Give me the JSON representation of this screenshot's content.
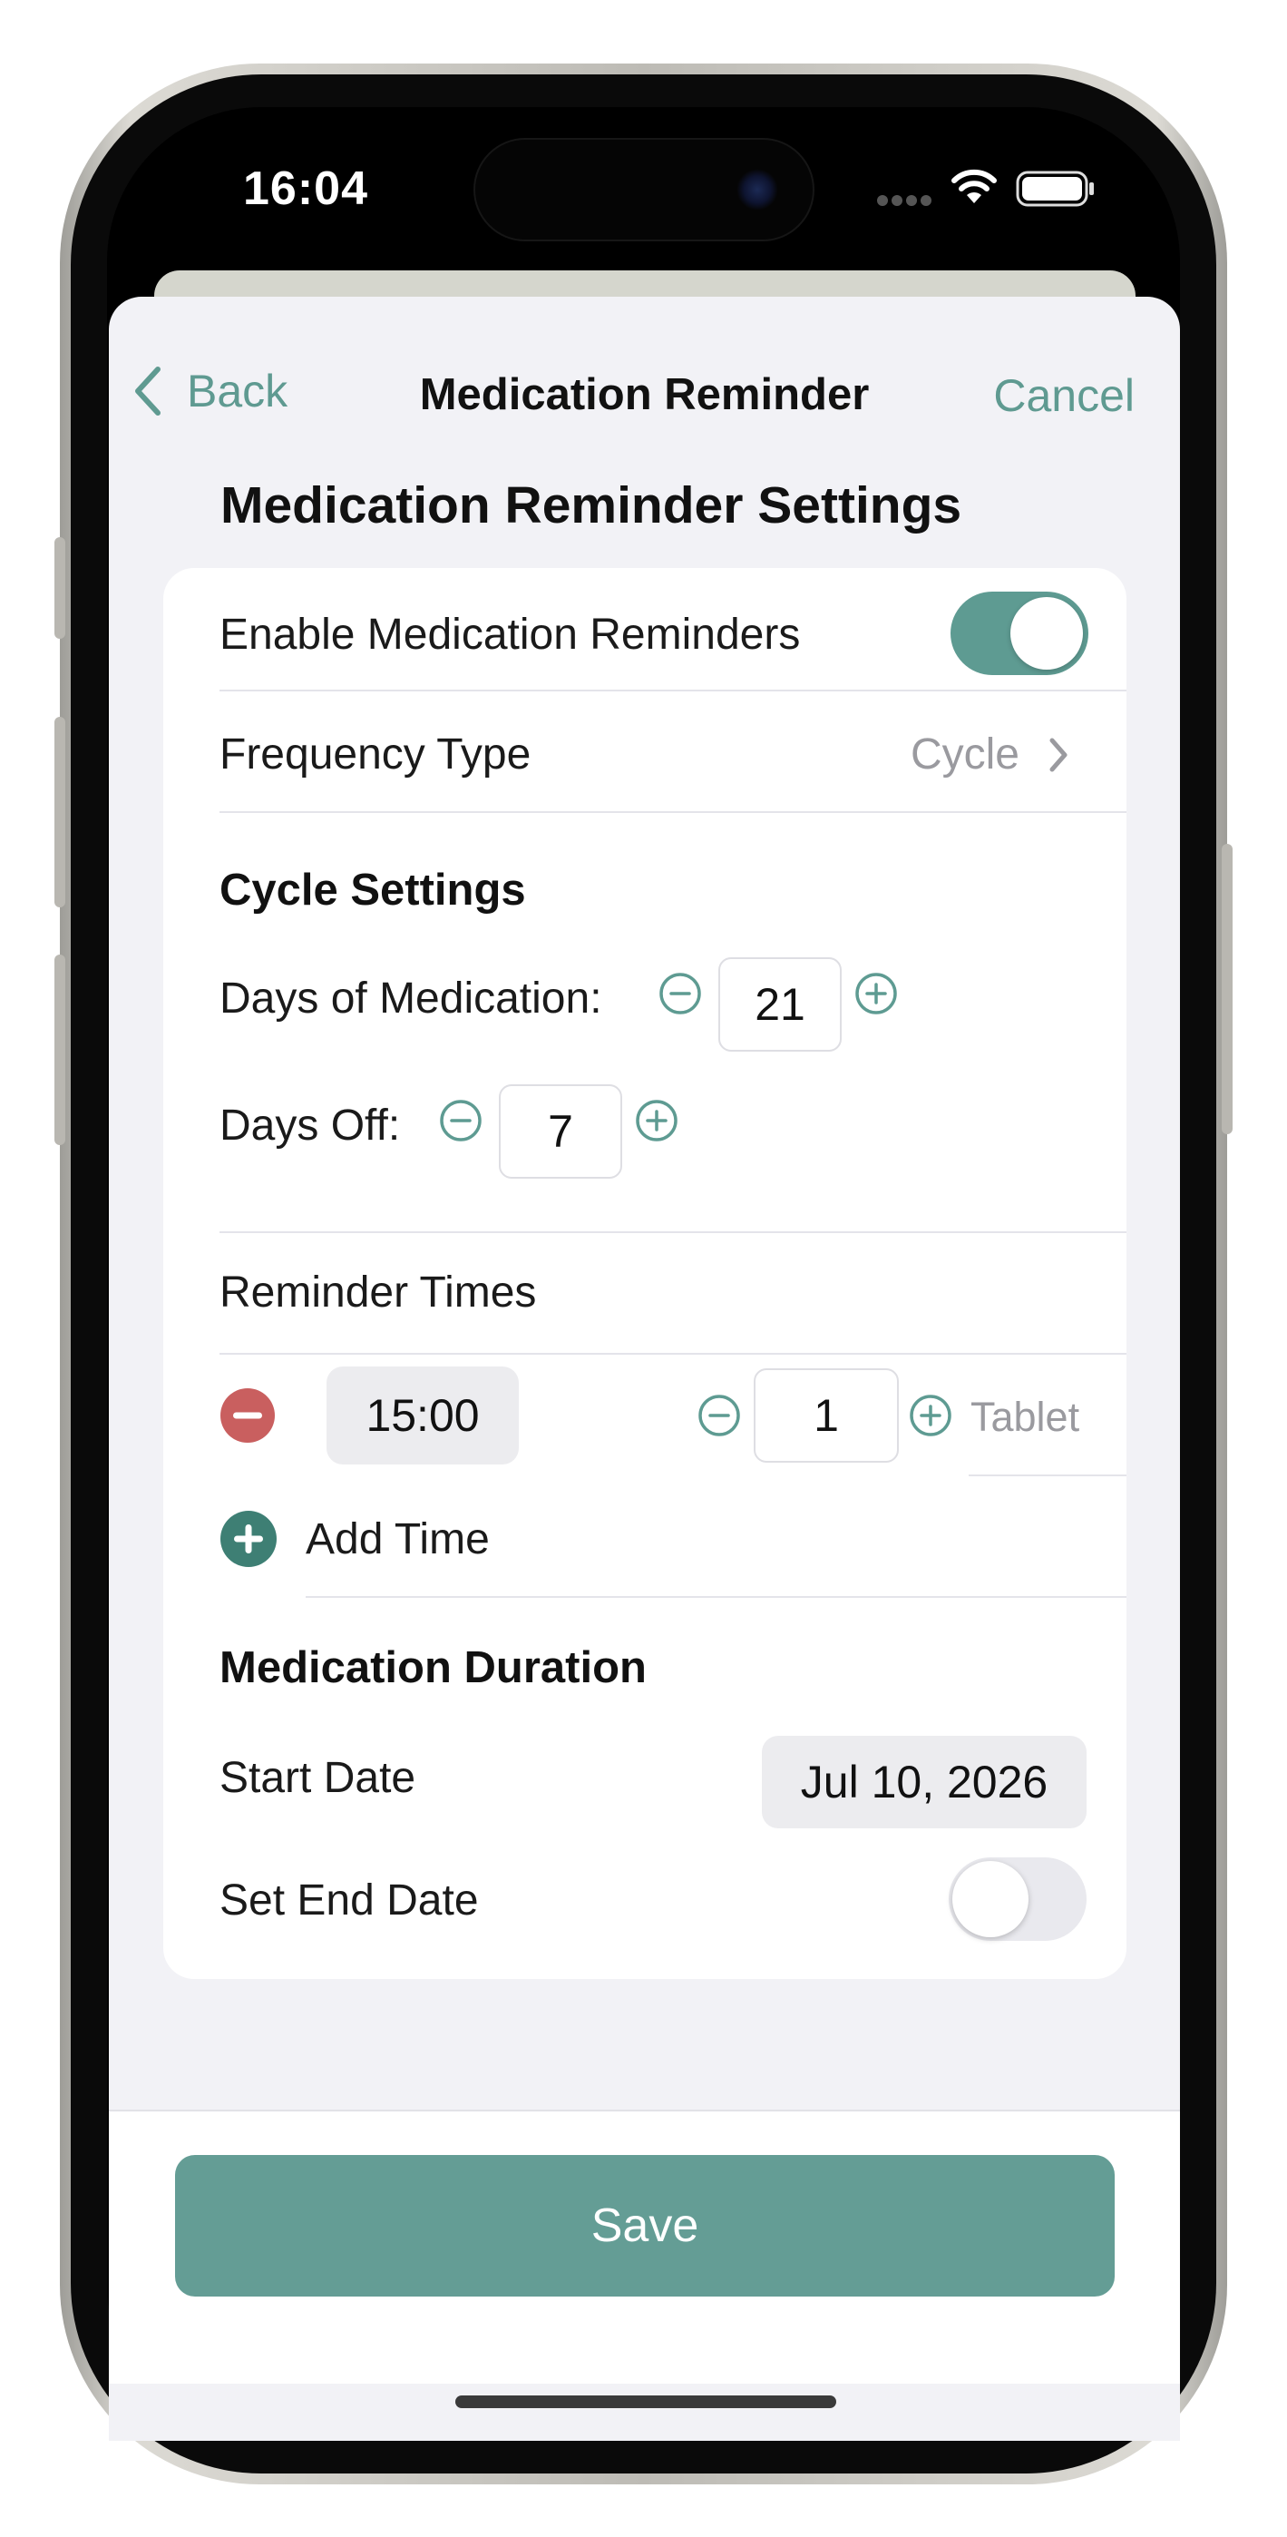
{
  "status_bar": {
    "time": "16:04",
    "icons": [
      "signal-dots-icon",
      "wifi-icon",
      "battery-icon"
    ]
  },
  "nav": {
    "back_label": "Back",
    "title": "Medication Reminder",
    "cancel_label": "Cancel"
  },
  "page_heading": "Medication Reminder Settings",
  "enable_row": {
    "label": "Enable Medication Reminders",
    "enabled": true
  },
  "frequency_row": {
    "label": "Frequency Type",
    "value": "Cycle"
  },
  "cycle_settings": {
    "heading": "Cycle Settings",
    "days_of_medication": {
      "label": "Days of Medication:",
      "value": "21"
    },
    "days_off": {
      "label": "Days Off:",
      "value": "7"
    }
  },
  "reminder_times": {
    "heading": "Reminder Times",
    "items": [
      {
        "time": "15:00",
        "dose": "1",
        "unit": "Tablet"
      }
    ],
    "add_label": "Add Time"
  },
  "duration": {
    "heading": "Medication Duration",
    "start_label": "Start Date",
    "start_value": "Jul 10, 2026",
    "end_label": "Set End Date",
    "end_enabled": false
  },
  "save_label": "Save",
  "colors": {
    "accent": "#5e9b92",
    "remove": "#c95f5f",
    "add": "#3e7f74"
  }
}
